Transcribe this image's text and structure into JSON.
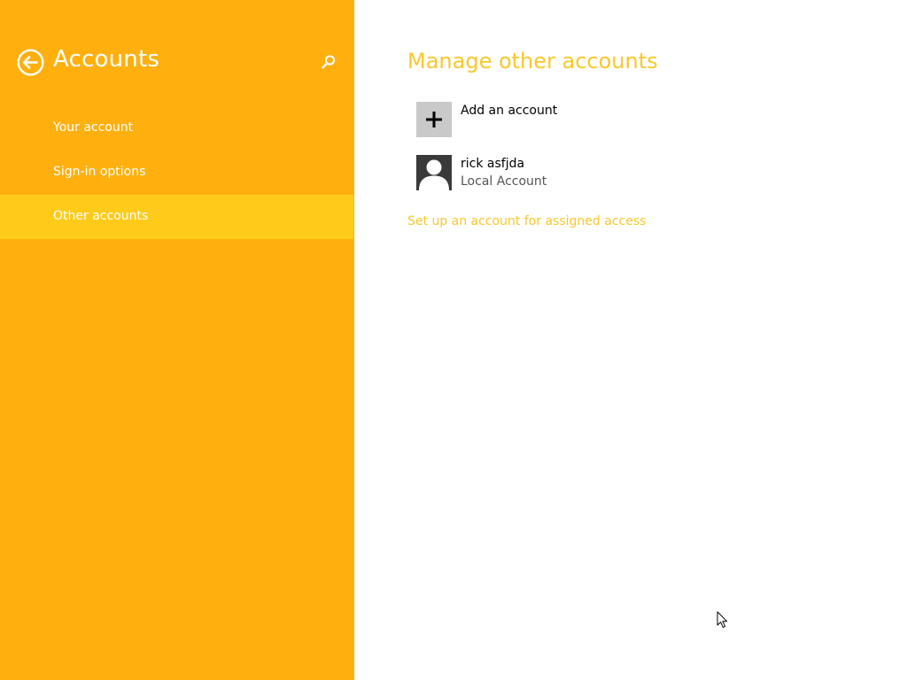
{
  "colors": {
    "sidebar_bg": "#FFB00F",
    "selected_bg": "#FFCB1A",
    "accent_text": "#F9C82C",
    "main_bg": "#FFFFFF"
  },
  "sidebar": {
    "back_icon": "back-arrow-circle-icon",
    "title": "Accounts",
    "search_icon": "search-icon",
    "items": [
      {
        "label": "Your account",
        "selected": false
      },
      {
        "label": "Sign-in options",
        "selected": false
      },
      {
        "label": "Other accounts",
        "selected": true
      }
    ]
  },
  "main": {
    "title": "Manage other accounts",
    "add_account": {
      "icon": "plus-icon",
      "label": "Add an account"
    },
    "accounts": [
      {
        "icon": "user-avatar-icon",
        "name": "rick asfjda",
        "type": "Local Account"
      }
    ],
    "assigned_access_link": "Set up an account for assigned access"
  }
}
